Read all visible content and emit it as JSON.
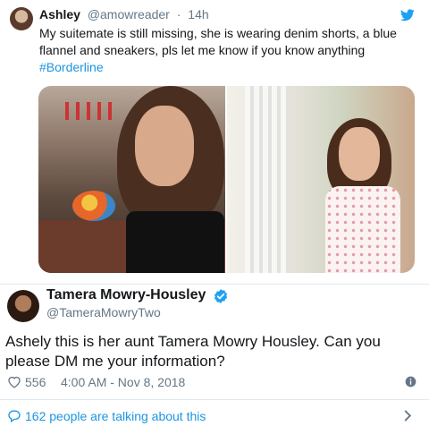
{
  "quoted_tweet": {
    "name": "Ashley",
    "handle": "@amowreader",
    "separator": "·",
    "time": "14h",
    "text": "My suitemate is still missing, she is wearing denim shorts, a blue flannel and sneakers, pls let me know if you know anything",
    "hashtag": "#Borderline",
    "media": [
      "photo-girl-holding-painted-rock",
      "photo-girl-white-floral-dress"
    ]
  },
  "main_tweet": {
    "name": "Tamera Mowry-Housley",
    "handle": "@TameraMowryTwo",
    "verified": true,
    "text": "Ashely this is her aunt Tamera Mowry Housley. Can you please DM me your information?",
    "likes": "556",
    "timestamp": "4:00 AM - Nov 8, 2018",
    "talking_about": "162 people are talking about this"
  },
  "colors": {
    "link": "#1b95e0",
    "secondary_text": "#657786",
    "primary_text": "#14171a",
    "divider": "#e1e8ed"
  },
  "icons": [
    "twitter-bird-icon",
    "verified-badge-icon",
    "heart-icon",
    "info-icon",
    "comment-icon",
    "chevron-right-icon"
  ]
}
